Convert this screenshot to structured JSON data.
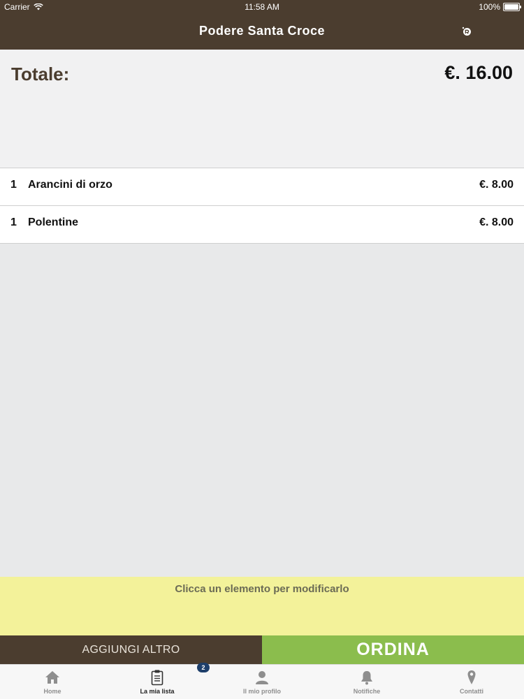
{
  "status_bar": {
    "carrier": "Carrier",
    "time": "11:58 AM",
    "battery": "100%"
  },
  "nav": {
    "title": "Podere Santa Croce",
    "action_icon": "refresh-icon"
  },
  "summary": {
    "total_label": "Totale:",
    "total_value": "€. 16.00"
  },
  "order": {
    "items": [
      {
        "qty": "1",
        "name": "Arancini di orzo",
        "price": "€. 8.00"
      },
      {
        "qty": "1",
        "name": "Polentine",
        "price": "€. 8.00"
      }
    ]
  },
  "hint": "Clicca un elemento per modificarlo",
  "actions": {
    "add_label": "AGGIUNGI ALTRO",
    "order_label": "ORDINA"
  },
  "tabs": [
    {
      "label": "Home",
      "icon": "home-icon"
    },
    {
      "label": "La mia lista",
      "icon": "clipboard-icon",
      "active": true
    },
    {
      "label": "Il mio profilo",
      "icon": "user-icon"
    },
    {
      "label": "Notifiche",
      "icon": "bell-icon"
    },
    {
      "label": "Contatti",
      "icon": "location-pin-icon"
    }
  ],
  "badge": "2",
  "colors": {
    "brand_brown": "#4b3d2f",
    "order_green": "#8bbd4d",
    "hint_yellow": "#f3f29a",
    "badge_blue": "#1e3f6b"
  }
}
